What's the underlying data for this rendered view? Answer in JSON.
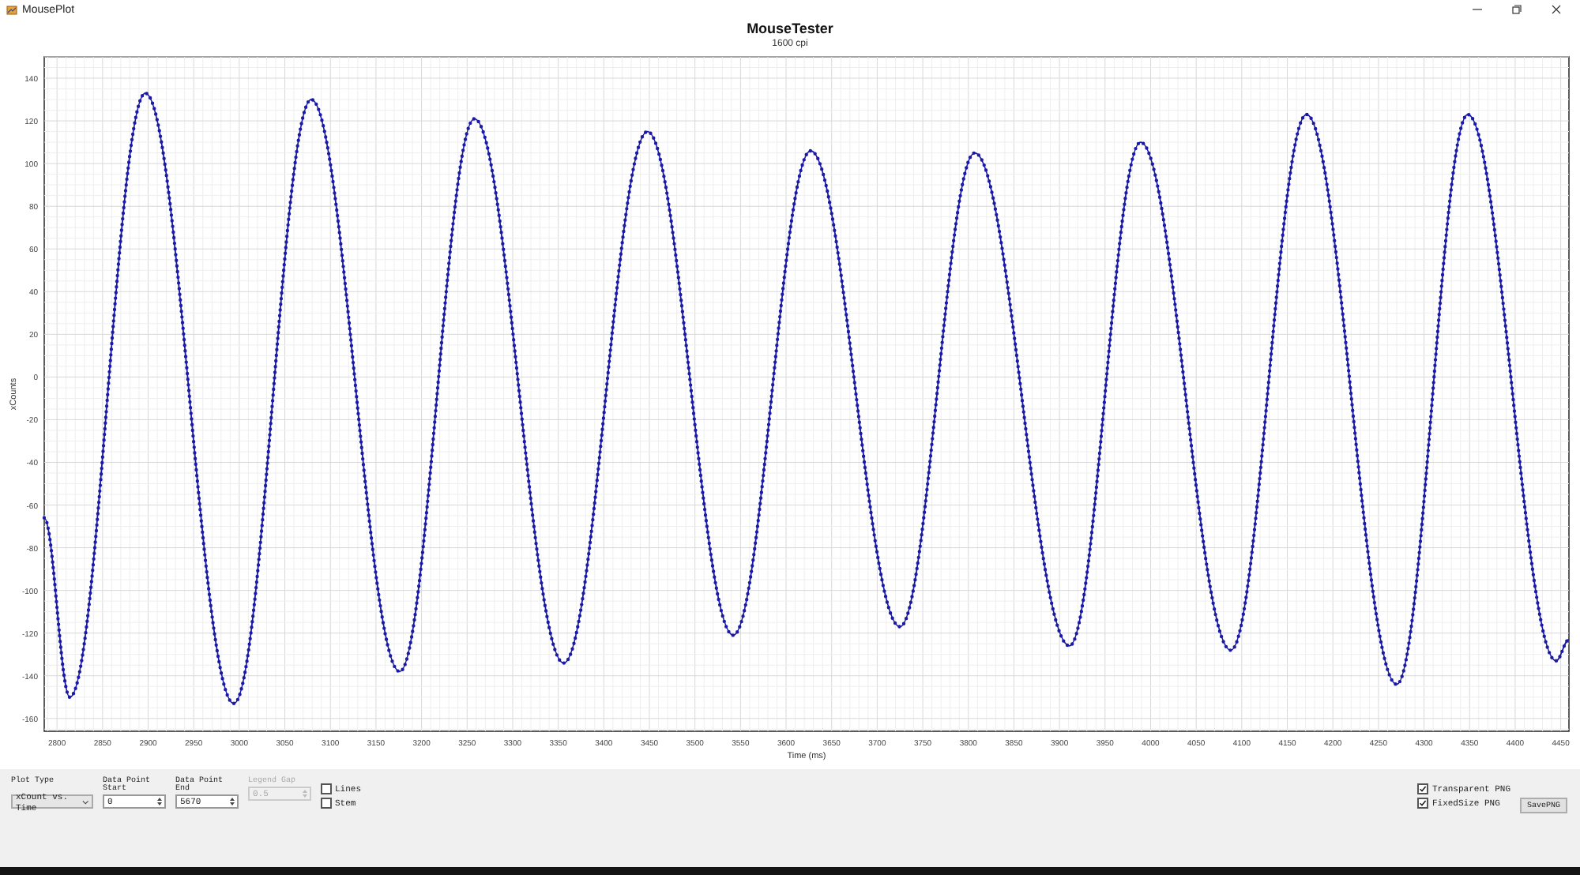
{
  "window": {
    "title": "MousePlot"
  },
  "plot": {
    "title": "MouseTester",
    "subtitle": "1600 cpi",
    "chart_data": {
      "type": "line",
      "xlabel": "Time (ms)",
      "ylabel": "xCounts",
      "x": [
        2786,
        2814,
        2897,
        2994,
        3079,
        3176,
        3258,
        3356,
        3448,
        3542,
        3627,
        3725,
        3807,
        3911,
        3989,
        4088,
        4171,
        4270,
        4348,
        4445,
        4459
      ],
      "grid": true,
      "series": [
        {
          "color": "#1a1aa6",
          "values": [
            -66,
            -150,
            133,
            -153,
            130,
            -138,
            121,
            -134,
            115,
            -121,
            106,
            -117,
            105,
            -126,
            110,
            -128,
            123,
            -144,
            123,
            -133,
            -123
          ]
        }
      ],
      "xlim": [
        2786,
        4459
      ],
      "ylim": [
        -166,
        150
      ],
      "xticks": [
        2800,
        2850,
        2900,
        2950,
        3000,
        3050,
        3100,
        3150,
        3200,
        3250,
        3300,
        3350,
        3400,
        3450,
        3500,
        3550,
        3600,
        3650,
        3700,
        3750,
        3800,
        3850,
        3900,
        3950,
        4000,
        4050,
        4100,
        4150,
        4200,
        4250,
        4300,
        4350,
        4400,
        4450
      ],
      "yticks": [
        -160,
        -140,
        -120,
        -100,
        -80,
        -60,
        -40,
        -20,
        0,
        20,
        40,
        60,
        80,
        100,
        120,
        140
      ]
    }
  },
  "controls": {
    "plot_type": {
      "label": "Plot Type",
      "value": "xCount vs. Time"
    },
    "spinners": [
      {
        "label": "Data Point Start",
        "value": "0",
        "disabled": false
      },
      {
        "label": "Data Point End",
        "value": "5670",
        "disabled": false
      },
      {
        "label": "Legend Gap",
        "value": "0.5",
        "disabled": true
      }
    ],
    "left_checks": [
      {
        "label": "Lines",
        "checked": false
      },
      {
        "label": "Stem",
        "checked": false
      }
    ],
    "right_checks": [
      {
        "label": "Transparent PNG",
        "checked": true
      },
      {
        "label": "FixedSize PNG",
        "checked": true
      }
    ],
    "save_button": "SavePNG"
  }
}
